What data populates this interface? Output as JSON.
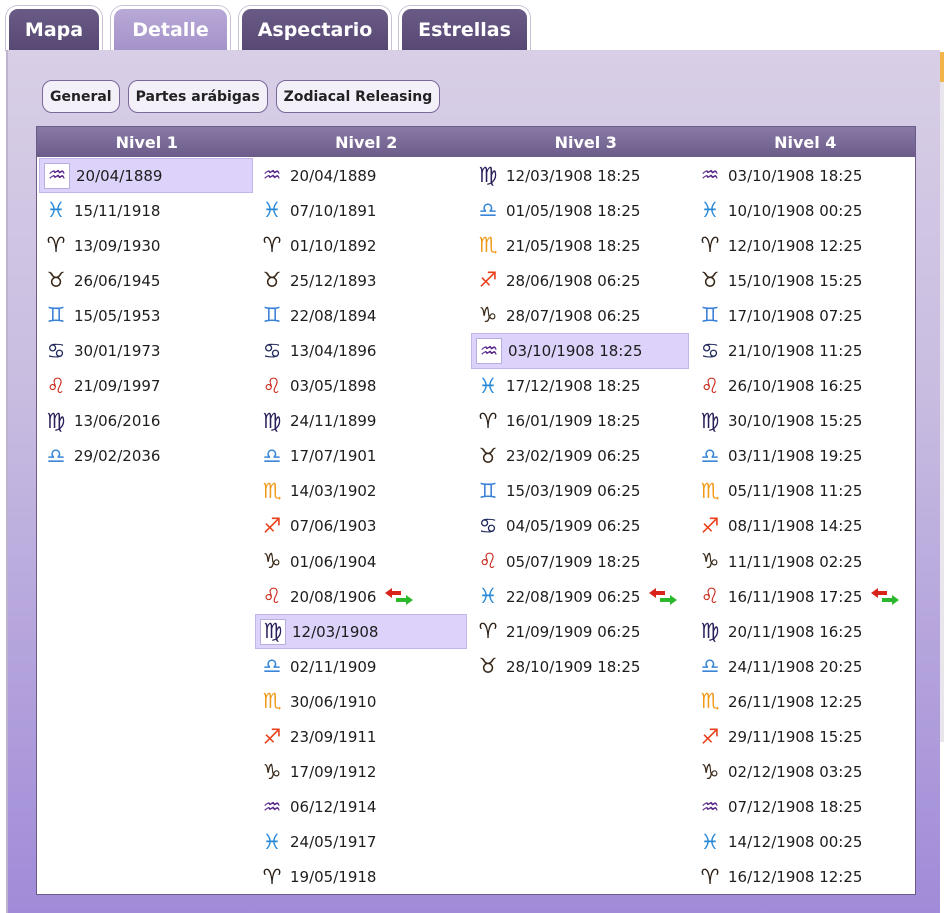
{
  "tabs": [
    "Mapa",
    "Detalle",
    "Aspectario",
    "Estrellas"
  ],
  "active_tab": "Detalle",
  "subnav": [
    "General",
    "Partes arábigas",
    "Zodiacal Releasing"
  ],
  "columns": [
    "Nivel 1",
    "Nivel 2",
    "Nivel 3",
    "Nivel 4"
  ],
  "signs": {
    "aries": {
      "glyph": "♈",
      "color": "#2a1e14"
    },
    "taurus": {
      "glyph": "♉",
      "color": "#3a2a1a"
    },
    "gemini": {
      "glyph": "♊",
      "color": "#3a7fd8"
    },
    "cancer": {
      "glyph": "♋",
      "color": "#202a5a"
    },
    "leo": {
      "glyph": "♌",
      "color": "#c8281a"
    },
    "virgo": {
      "glyph": "♍",
      "color": "#28205a"
    },
    "libra": {
      "glyph": "♎",
      "color": "#3a86d8"
    },
    "scorpio": {
      "glyph": "♏",
      "color": "#f09a1a"
    },
    "sagittarius": {
      "glyph": "♐",
      "color": "#e8401a"
    },
    "capricorn": {
      "glyph": "♑",
      "color": "#3a2a1a"
    },
    "aquarius": {
      "glyph": "♒",
      "color": "#5a2a8a"
    },
    "pisces": {
      "glyph": "♓",
      "color": "#2a8ad8"
    }
  },
  "levels": [
    [
      {
        "sign": "aquarius",
        "date": "20/04/1889",
        "selected": true
      },
      {
        "sign": "pisces",
        "date": "15/11/1918"
      },
      {
        "sign": "aries",
        "date": "13/09/1930"
      },
      {
        "sign": "taurus",
        "date": "26/06/1945"
      },
      {
        "sign": "gemini",
        "date": "15/05/1953"
      },
      {
        "sign": "cancer",
        "date": "30/01/1973"
      },
      {
        "sign": "leo",
        "date": "21/09/1997"
      },
      {
        "sign": "virgo",
        "date": "13/06/2016"
      },
      {
        "sign": "libra",
        "date": "29/02/2036"
      }
    ],
    [
      {
        "sign": "aquarius",
        "date": "20/04/1889"
      },
      {
        "sign": "pisces",
        "date": "07/10/1891"
      },
      {
        "sign": "aries",
        "date": "01/10/1892"
      },
      {
        "sign": "taurus",
        "date": "25/12/1893"
      },
      {
        "sign": "gemini",
        "date": "22/08/1894"
      },
      {
        "sign": "cancer",
        "date": "13/04/1896"
      },
      {
        "sign": "leo",
        "date": "03/05/1898"
      },
      {
        "sign": "virgo",
        "date": "24/11/1899"
      },
      {
        "sign": "libra",
        "date": "17/07/1901"
      },
      {
        "sign": "scorpio",
        "date": "14/03/1902"
      },
      {
        "sign": "sagittarius",
        "date": "07/06/1903"
      },
      {
        "sign": "capricorn",
        "date": "01/06/1904"
      },
      {
        "sign": "leo",
        "date": "20/08/1906",
        "loosing": true
      },
      {
        "sign": "virgo",
        "date": "12/03/1908",
        "selected": true
      },
      {
        "sign": "libra",
        "date": "02/11/1909"
      },
      {
        "sign": "scorpio",
        "date": "30/06/1910"
      },
      {
        "sign": "sagittarius",
        "date": "23/09/1911"
      },
      {
        "sign": "capricorn",
        "date": "17/09/1912"
      },
      {
        "sign": "aquarius",
        "date": "06/12/1914"
      },
      {
        "sign": "pisces",
        "date": "24/05/1917"
      },
      {
        "sign": "aries",
        "date": "19/05/1918"
      }
    ],
    [
      {
        "sign": "virgo",
        "date": "12/03/1908 18:25"
      },
      {
        "sign": "libra",
        "date": "01/05/1908 18:25"
      },
      {
        "sign": "scorpio",
        "date": "21/05/1908 18:25"
      },
      {
        "sign": "sagittarius",
        "date": "28/06/1908 06:25"
      },
      {
        "sign": "capricorn",
        "date": "28/07/1908 06:25"
      },
      {
        "sign": "aquarius",
        "date": "03/10/1908 18:25",
        "selected": true
      },
      {
        "sign": "pisces",
        "date": "17/12/1908 18:25"
      },
      {
        "sign": "aries",
        "date": "16/01/1909 18:25"
      },
      {
        "sign": "taurus",
        "date": "23/02/1909 06:25"
      },
      {
        "sign": "gemini",
        "date": "15/03/1909 06:25"
      },
      {
        "sign": "cancer",
        "date": "04/05/1909 06:25"
      },
      {
        "sign": "leo",
        "date": "05/07/1909 18:25"
      },
      {
        "sign": "pisces",
        "date": "22/08/1909 06:25",
        "loosing": true
      },
      {
        "sign": "aries",
        "date": "21/09/1909 06:25"
      },
      {
        "sign": "taurus",
        "date": "28/10/1909 18:25"
      }
    ],
    [
      {
        "sign": "aquarius",
        "date": "03/10/1908 18:25"
      },
      {
        "sign": "pisces",
        "date": "10/10/1908 00:25"
      },
      {
        "sign": "aries",
        "date": "12/10/1908 12:25"
      },
      {
        "sign": "taurus",
        "date": "15/10/1908 15:25"
      },
      {
        "sign": "gemini",
        "date": "17/10/1908 07:25"
      },
      {
        "sign": "cancer",
        "date": "21/10/1908 11:25"
      },
      {
        "sign": "leo",
        "date": "26/10/1908 16:25"
      },
      {
        "sign": "virgo",
        "date": "30/10/1908 15:25"
      },
      {
        "sign": "libra",
        "date": "03/11/1908 19:25"
      },
      {
        "sign": "scorpio",
        "date": "05/11/1908 11:25"
      },
      {
        "sign": "sagittarius",
        "date": "08/11/1908 14:25"
      },
      {
        "sign": "capricorn",
        "date": "11/11/1908 02:25"
      },
      {
        "sign": "leo",
        "date": "16/11/1908 17:25",
        "loosing": true
      },
      {
        "sign": "virgo",
        "date": "20/11/1908 16:25"
      },
      {
        "sign": "libra",
        "date": "24/11/1908 20:25"
      },
      {
        "sign": "scorpio",
        "date": "26/11/1908 12:25"
      },
      {
        "sign": "sagittarius",
        "date": "29/11/1908 15:25"
      },
      {
        "sign": "capricorn",
        "date": "02/12/1908 03:25"
      },
      {
        "sign": "aquarius",
        "date": "07/12/1908 18:25"
      },
      {
        "sign": "pisces",
        "date": "14/12/1908 00:25"
      },
      {
        "sign": "aries",
        "date": "16/12/1908 12:25"
      }
    ]
  ]
}
